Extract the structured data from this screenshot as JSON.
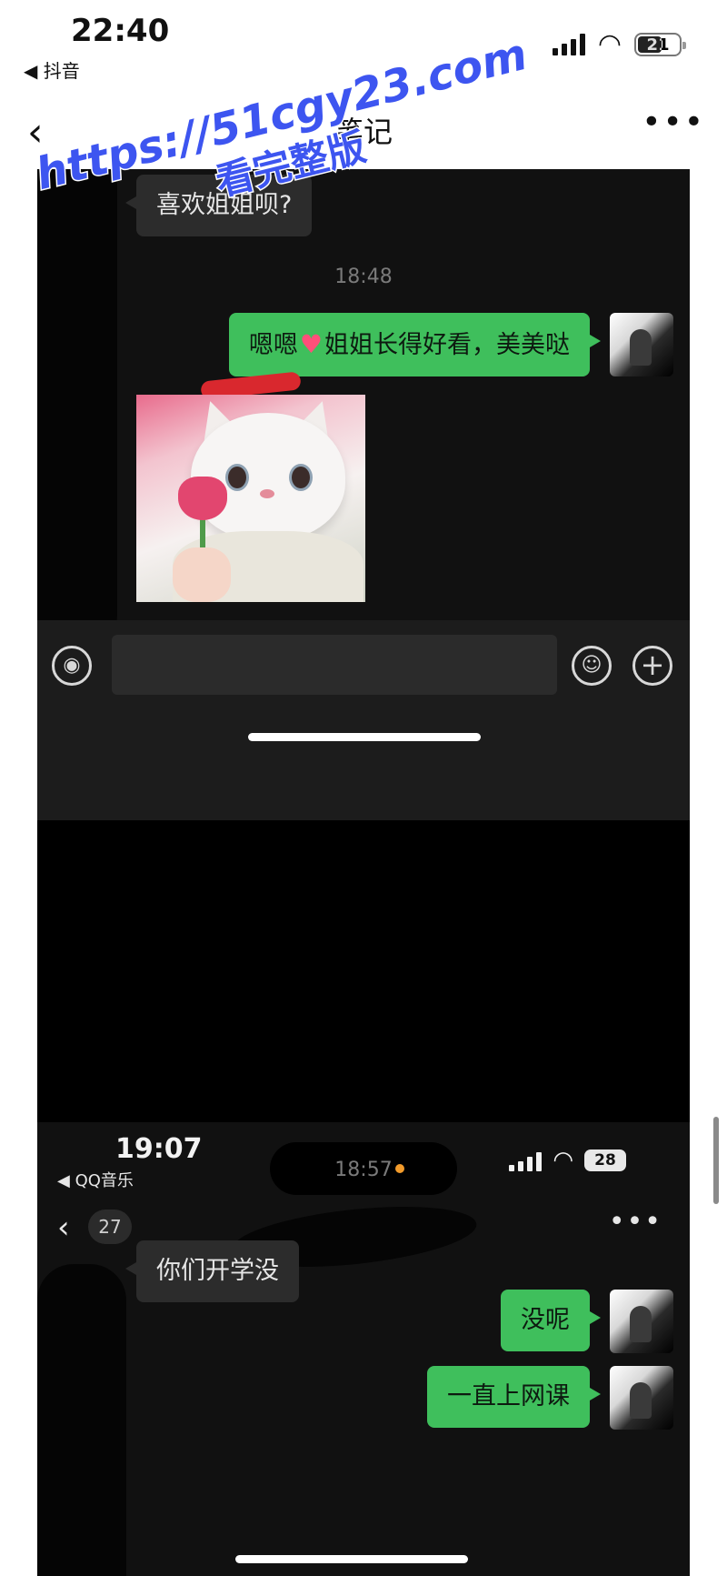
{
  "status_bar": {
    "time": "22:40",
    "back_app": "◀ 抖音",
    "battery": "21"
  },
  "nav": {
    "back_icon": "‹",
    "title": "笔记",
    "more": "•••"
  },
  "watermark": {
    "url": "https://51cgy23.com",
    "cta": "看完整版"
  },
  "chat1": {
    "incoming_text": "喜欢姐姐呗?",
    "timestamp": "18:48",
    "outgoing_prefix": "嗯嗯",
    "outgoing_suffix": "姐姐长得好看，美美哒",
    "heart_icon": "♥"
  },
  "chat1_input": {
    "voice_icon": "◉",
    "emoji_icon": "☺",
    "plus_icon": "+"
  },
  "chat2": {
    "status_time": "19:07",
    "back_app": "◀ QQ音乐",
    "battery": "28",
    "back_icon": "‹",
    "unread_count": "27",
    "more": "•••",
    "timestamp": "18:57",
    "incoming_text": "你们开学没",
    "outgoing_1": "没呢",
    "outgoing_2": "一直上网课"
  }
}
